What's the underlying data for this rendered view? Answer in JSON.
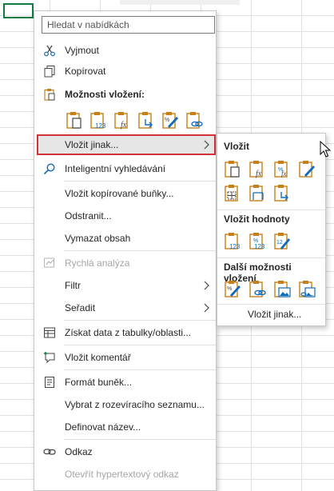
{
  "search": {
    "placeholder": "Hledat v nabídkách"
  },
  "menu": {
    "cut": "Vyjmout",
    "copy": "Kopírovat",
    "paste_options_title": "Možnosti vložení:",
    "paste_special": "Vložit jinak...",
    "smart_lookup": "Inteligentní vyhledávání",
    "insert_copied_cells": "Vložit kopírované buňky...",
    "delete": "Odstranit...",
    "clear_contents": "Vymazat obsah",
    "quick_analysis": "Rychlá analýza",
    "filter": "Filtr",
    "sort": "Seřadit",
    "get_data": "Získat data z tabulky/oblasti...",
    "insert_comment": "Vložit komentář",
    "format_cells": "Formát buněk...",
    "pick_from_list": "Vybrat z rozevíracího seznamu...",
    "define_name": "Definovat název...",
    "link": "Odkaz",
    "open_hyperlink": "Otevřít hypertextový odkaz"
  },
  "submenu": {
    "paste_title": "Vložit",
    "paste_values_title": "Vložit hodnoty",
    "other_paste_title": "Další možnosti vložení",
    "paste_special_link": "Vložit jinak..."
  },
  "icons": {
    "paste_options": [
      "paste-icon",
      "paste-values-icon",
      "paste-formulas-icon",
      "paste-transpose-icon",
      "paste-formatting-icon",
      "paste-link-icon"
    ],
    "colors": {
      "accent": "#0f6cbd",
      "clipboard": "#c57f1b",
      "highlight_border": "#d13438",
      "selection": "#107c41"
    }
  }
}
